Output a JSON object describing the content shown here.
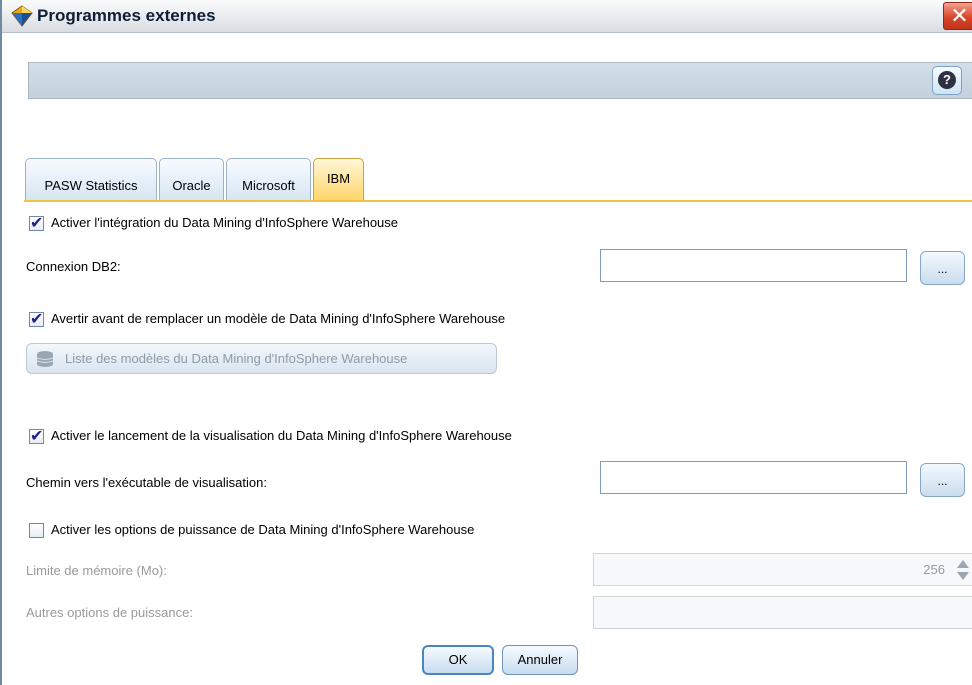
{
  "window": {
    "title": "Programmes externes",
    "close_glyph": "✕",
    "help_glyph": "?"
  },
  "tabs": [
    {
      "label": "PASW Statistics",
      "active": false
    },
    {
      "label": "Oracle",
      "active": false
    },
    {
      "label": "Microsoft",
      "active": false
    },
    {
      "label": "IBM",
      "active": true
    }
  ],
  "ibm": {
    "enable_integration": {
      "label": "Activer l'intégration du Data Mining d'InfoSphere Warehouse",
      "checked": true
    },
    "db2_connection": {
      "label": "Connexion DB2:",
      "value": "",
      "browse_label": "..."
    },
    "warn_replace": {
      "label": "Avertir avant de remplacer un modèle de Data Mining d'InfoSphere Warehouse",
      "checked": true
    },
    "list_models_button": "Liste des modèles du Data Mining d'InfoSphere Warehouse",
    "enable_visualization": {
      "label": "Activer le lancement de la visualisation du Data Mining d'InfoSphere Warehouse",
      "checked": true
    },
    "visualization_path": {
      "label": "Chemin vers l'exécutable de visualisation:",
      "value": "",
      "browse_label": "..."
    },
    "enable_power_options": {
      "label": "Activer les options de puissance de Data Mining d'InfoSphere Warehouse",
      "checked": false
    },
    "memory_limit": {
      "label": "Limite de mémoire (Mo):",
      "value": "256"
    },
    "other_power_options": {
      "label": "Autres options de puissance:",
      "value": ""
    }
  },
  "buttons": {
    "ok": "OK",
    "cancel": "Annuler"
  },
  "icons": {
    "title": "diamond-app-icon",
    "help": "help-icon",
    "database": "database-icon"
  },
  "colors": {
    "active_tab": "#ffd56b",
    "close_button": "#d9462a",
    "tab_underline": "#f3c443"
  }
}
